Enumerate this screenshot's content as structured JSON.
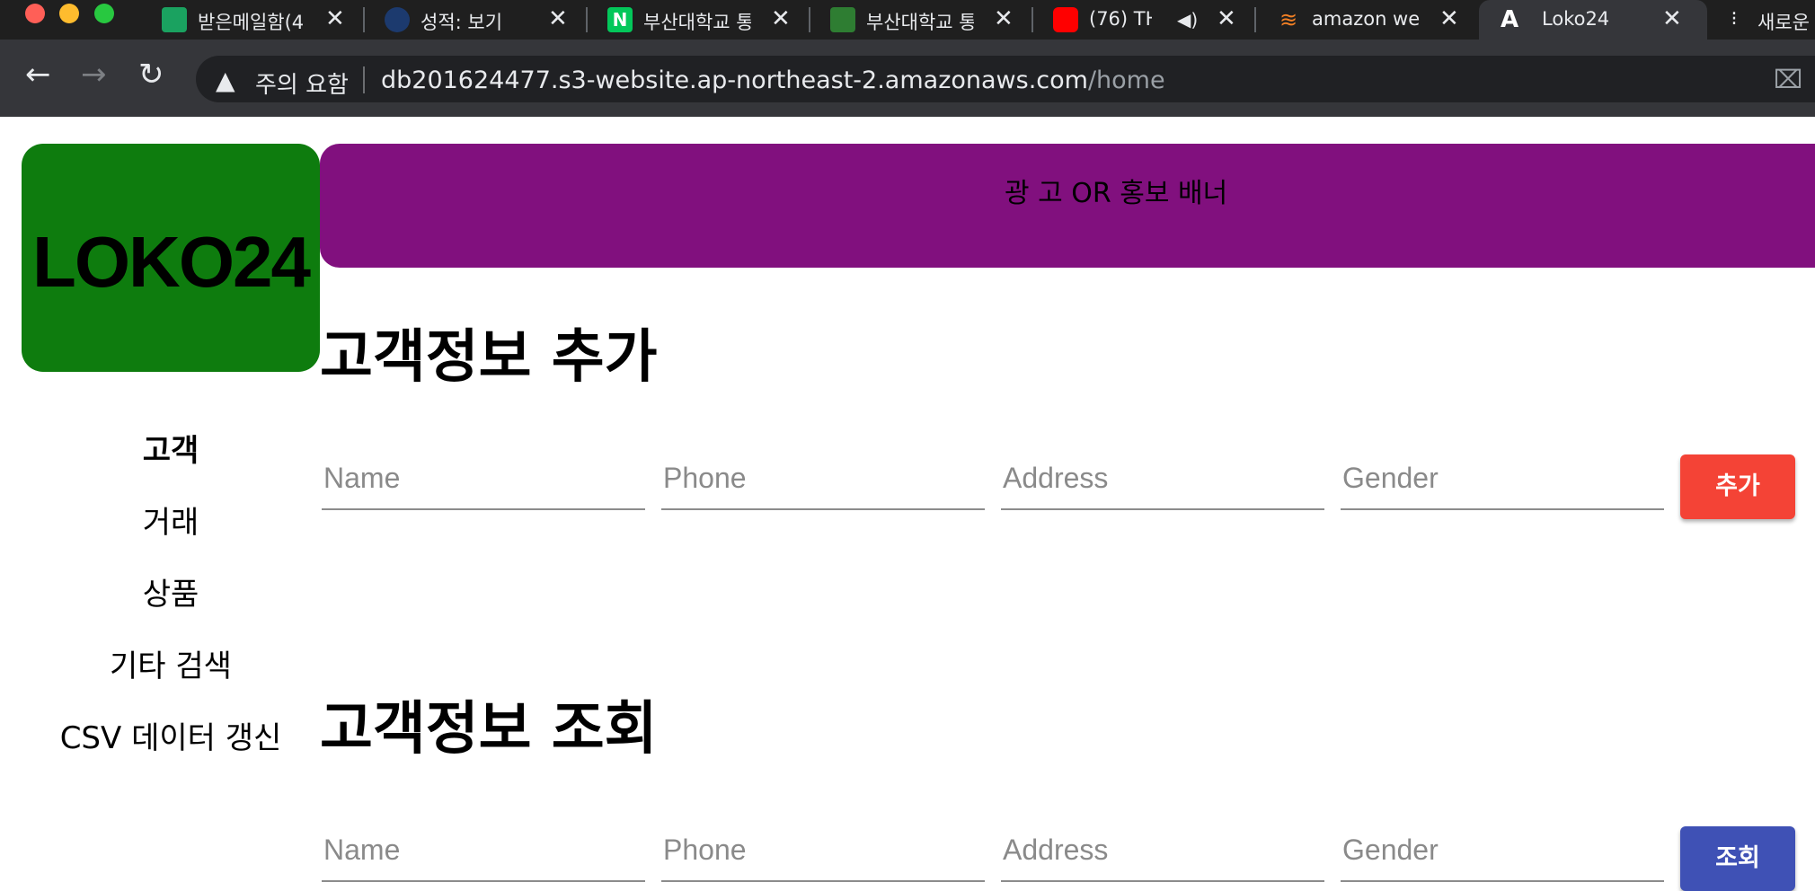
{
  "browser": {
    "tabs": [
      {
        "label": "받은메일함(4",
        "favicon_color": "#1aa260"
      },
      {
        "label": "성적: 보기",
        "favicon_color": "#1c3a6e"
      },
      {
        "label": "부산대학교 통",
        "favicon_color": "#03c75a",
        "favicon_glyph": "N"
      },
      {
        "label": "부산대학교 통",
        "favicon_color": "#2e7d32"
      },
      {
        "label": "(76) TH",
        "favicon_color": "#ff0000"
      },
      {
        "label": "amazon we",
        "favicon_color": "#f48024"
      },
      {
        "label": "Loko24",
        "favicon_color": "#000000",
        "favicon_glyph": "A"
      },
      {
        "label": "새로운",
        "favicon_color": "#e8eaed"
      }
    ],
    "audio_icon": "speaker-icon",
    "security_label": "주의 요함",
    "url_host": "db201624477.s3-website.ap-northeast-2.amazonaws.com",
    "url_path": "/home"
  },
  "page": {
    "logo": "LOKO24",
    "banner": "광 고 OR 홍보 배너",
    "nav": [
      "고객",
      "거래",
      "상품",
      "기타 검색",
      "CSV 데이터 갱신"
    ],
    "add_section": {
      "title": "고객정보 추가",
      "fields": [
        "Name",
        "Phone",
        "Address",
        "Gender"
      ],
      "button": "추가"
    },
    "search_section": {
      "title": "고객정보 조회",
      "fields": [
        "Name",
        "Phone",
        "Address",
        "Gender"
      ],
      "button": "조회"
    }
  },
  "colors": {
    "logo_bg": "#0e7c0e",
    "banner_bg": "#81107e",
    "add_button": "#f44336",
    "search_button": "#3f51b5"
  }
}
